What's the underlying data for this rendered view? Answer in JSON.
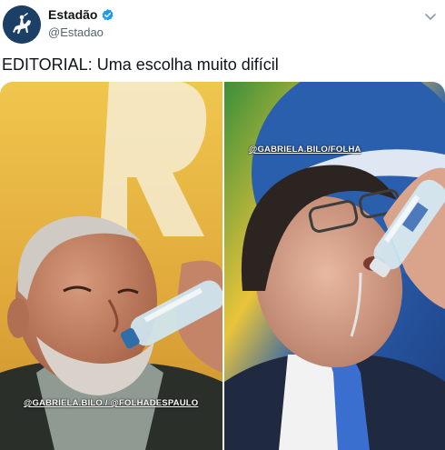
{
  "tweet": {
    "display_name": "Estadão",
    "handle": "@Estadao",
    "text": "EDITORIAL: Uma escolha muito difícil",
    "verified": true,
    "verified_color": "#1d9bf0"
  },
  "media": {
    "left_photo": {
      "credit": "@GABRIELA.BILO / @FOLHADESPAULO",
      "background_color": "#e8b94a"
    },
    "right_photo": {
      "credit": "@GABRIELA.BILO/FOLHA",
      "background_color": "#2a6bb8"
    }
  },
  "icons": {
    "avatar": "estadao-logo-icon",
    "verified": "verified-badge-icon",
    "more": "chevron-down-icon"
  }
}
